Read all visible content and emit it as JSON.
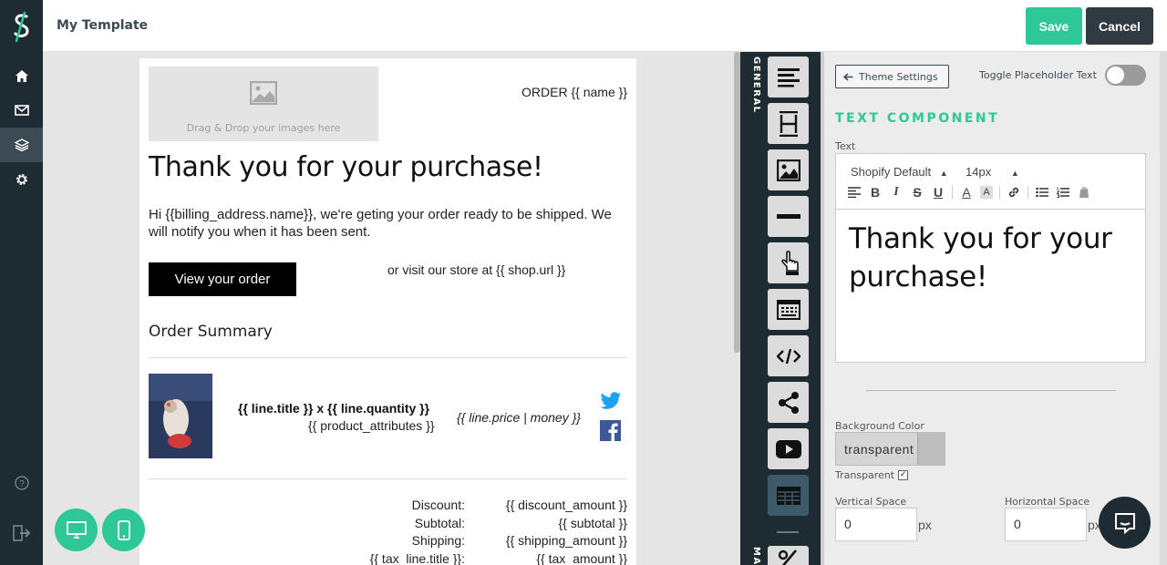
{
  "app": {
    "title": "My Template"
  },
  "header": {
    "save_label": "Save",
    "cancel_label": "Cancel"
  },
  "sidebar": {
    "items": [
      {
        "icon": "home-icon"
      },
      {
        "icon": "mail-icon"
      },
      {
        "icon": "layers-icon",
        "active": true
      },
      {
        "icon": "gear-icon"
      }
    ],
    "bottom": [
      {
        "icon": "help-icon"
      },
      {
        "icon": "logout-icon"
      }
    ]
  },
  "canvas": {
    "image_placeholder": "Drag & Drop your images here",
    "order_name": "ORDER {{ name }}",
    "headline": "Thank you for your purchase!",
    "intro": "Hi {{billing_address.name}}, we're geting your order ready to be shipped. We will notify you when it has been sent.",
    "view_button": "View your order",
    "visit_text": "or visit our store at {{ shop.url }}",
    "summary_title": "Order Summary",
    "line_title": "{{ line.title }} x {{ line.quantity }}",
    "line_attributes": "{{ product_attributes }}",
    "line_price": "{{ line.price | money }}",
    "totals": {
      "labels": [
        "Discount:",
        "Subtotal:",
        "Shipping:",
        "{{ tax_line.title }}:"
      ],
      "values": [
        "{{ discount_amount }}",
        "{{ subtotal }}",
        "{{ shipping_amount }}",
        "{{ tax_amount }}"
      ]
    }
  },
  "toolstrip": {
    "tab_general": "GENERAL",
    "tab_main": "MAI",
    "tools": [
      "text-align-icon",
      "spacer-icon",
      "image-icon",
      "divider-icon",
      "button-icon",
      "html-block-icon",
      "code-icon",
      "share-icon",
      "youtube-icon",
      "table-icon",
      "percent-icon"
    ],
    "active_tool": "table-icon"
  },
  "panel": {
    "theme_settings": "Theme Settings",
    "toggle_label": "Toggle Placeholder Text",
    "toggle_on": false,
    "section_title": "TEXT COMPONENT",
    "text_label": "Text",
    "font_select": "Shopify Default",
    "size_select": "14px",
    "editor_content": "Thank you for your purchase!",
    "bg_color_label": "Background Color",
    "bg_color_value": "transparent",
    "transparent_label": "Transparent",
    "transparent_checked": true,
    "vertical_space_label": "Vertical Space",
    "vertical_space_value": "0",
    "horizontal_space_label": "Horizontal Space",
    "horizontal_space_value": "0",
    "px_unit": "px"
  },
  "colors": {
    "accent": "#2ec896",
    "dark": "#1f2b33",
    "cancel": "#2f3a42"
  }
}
